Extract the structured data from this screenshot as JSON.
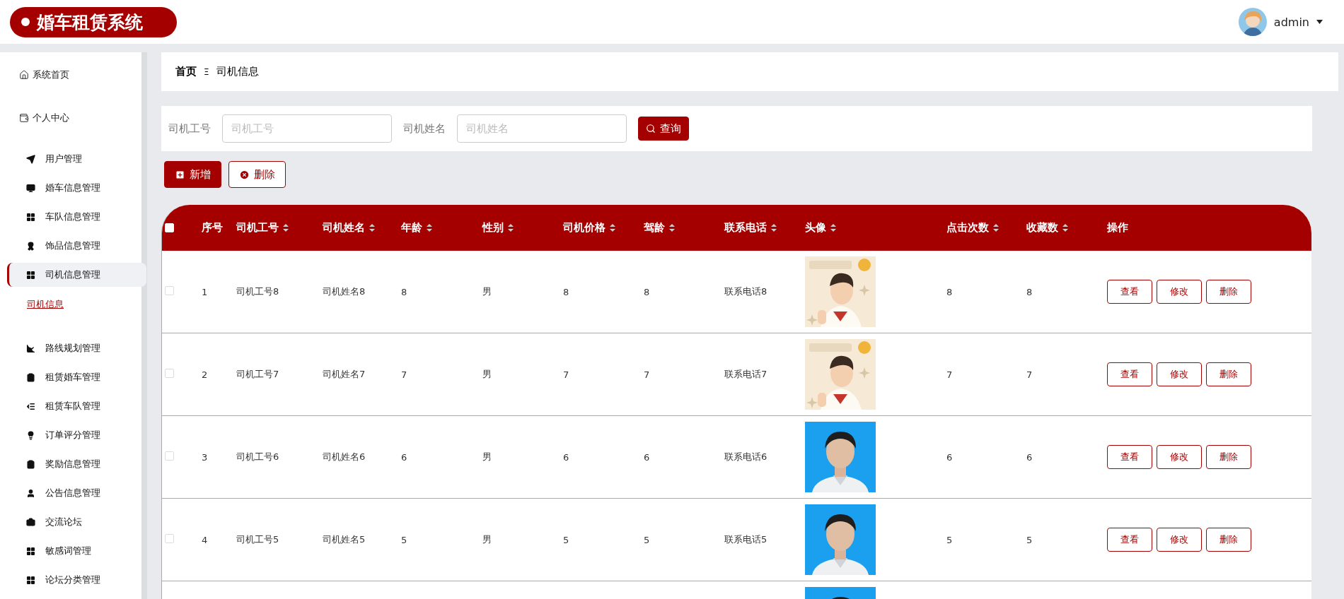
{
  "header": {
    "logo": "婚车租赁系统",
    "user": "admin"
  },
  "sidebar": {
    "items": [
      {
        "label": "系统首页",
        "kind": "home",
        "selected": false
      },
      {
        "label": "个人中心",
        "kind": "group",
        "selected": false
      },
      {
        "label": "用户管理",
        "kind": "menu",
        "selected": false
      },
      {
        "label": "婚车信息管理",
        "kind": "menu",
        "selected": false
      },
      {
        "label": "车队信息管理",
        "kind": "menu",
        "selected": false
      },
      {
        "label": "饰品信息管理",
        "kind": "menu",
        "selected": false
      },
      {
        "label": "司机信息管理",
        "kind": "menu",
        "selected": true,
        "children": [
          {
            "label": "司机信息",
            "selected": true
          }
        ]
      },
      {
        "label": "路线规划管理",
        "kind": "menu",
        "selected": false
      },
      {
        "label": "租赁婚车管理",
        "kind": "menu",
        "selected": false
      },
      {
        "label": "租赁车队管理",
        "kind": "menu",
        "selected": false
      },
      {
        "label": "订单评分管理",
        "kind": "menu",
        "selected": false
      },
      {
        "label": "奖励信息管理",
        "kind": "menu",
        "selected": false
      },
      {
        "label": "公告信息管理",
        "kind": "menu",
        "selected": false
      },
      {
        "label": "交流论坛",
        "kind": "menu",
        "selected": false
      },
      {
        "label": "敏感词管理",
        "kind": "menu",
        "selected": false
      },
      {
        "label": "论坛分类管理",
        "kind": "menu",
        "selected": false
      }
    ]
  },
  "breadcrumb": {
    "home": "首页",
    "separator": "Ξ",
    "current": "司机信息"
  },
  "search": {
    "fields": [
      {
        "label": "司机工号",
        "placeholder": "司机工号"
      },
      {
        "label": "司机姓名",
        "placeholder": "司机姓名"
      }
    ],
    "button": "查询"
  },
  "actions": {
    "add": "新增",
    "delete": "删除"
  },
  "table": {
    "select_all": {
      "checked": false
    },
    "columns": [
      {
        "label": "序号",
        "sortable": false
      },
      {
        "label": "司机工号",
        "sortable": true
      },
      {
        "label": "司机姓名",
        "sortable": true
      },
      {
        "label": "年龄",
        "sortable": true
      },
      {
        "label": "性别",
        "sortable": true
      },
      {
        "label": "司机价格",
        "sortable": true
      },
      {
        "label": "驾龄",
        "sortable": true
      },
      {
        "label": "联系电话",
        "sortable": true
      },
      {
        "label": "头像",
        "sortable": true
      },
      {
        "label": "点击次数",
        "sortable": true
      },
      {
        "label": "收藏数",
        "sortable": true
      },
      {
        "label": "操作",
        "sortable": false
      }
    ],
    "rows": [
      {
        "checked": false,
        "cells": [
          "1",
          "司机工号8",
          "司机姓名8",
          "8",
          "男",
          "8",
          "8",
          "联系电话8"
        ],
        "avatar": {
          "kind": "picture"
        },
        "clicks": "8",
        "favorites": "8",
        "buttons": [
          "查看",
          "修改",
          "删除"
        ]
      },
      {
        "checked": false,
        "cells": [
          "2",
          "司机工号7",
          "司机姓名7",
          "7",
          "男",
          "7",
          "7",
          "联系电话7"
        ],
        "avatar": {
          "kind": "picture"
        },
        "clicks": "7",
        "favorites": "7",
        "buttons": [
          "查看",
          "修改",
          "删除"
        ]
      },
      {
        "checked": false,
        "cells": [
          "3",
          "司机工号6",
          "司机姓名6",
          "6",
          "男",
          "6",
          "6",
          "联系电话6"
        ],
        "avatar": {
          "kind": "picture"
        },
        "clicks": "6",
        "favorites": "6",
        "buttons": [
          "查看",
          "修改",
          "删除"
        ]
      },
      {
        "checked": false,
        "cells": [
          "4",
          "司机工号5",
          "司机姓名5",
          "5",
          "男",
          "5",
          "5",
          "联系电话5"
        ],
        "avatar": {
          "kind": "picture"
        },
        "clicks": "5",
        "favorites": "5",
        "buttons": [
          "查看",
          "修改",
          "删除"
        ]
      },
      {
        "avatar": {
          "kind": "picture"
        }
      }
    ]
  }
}
